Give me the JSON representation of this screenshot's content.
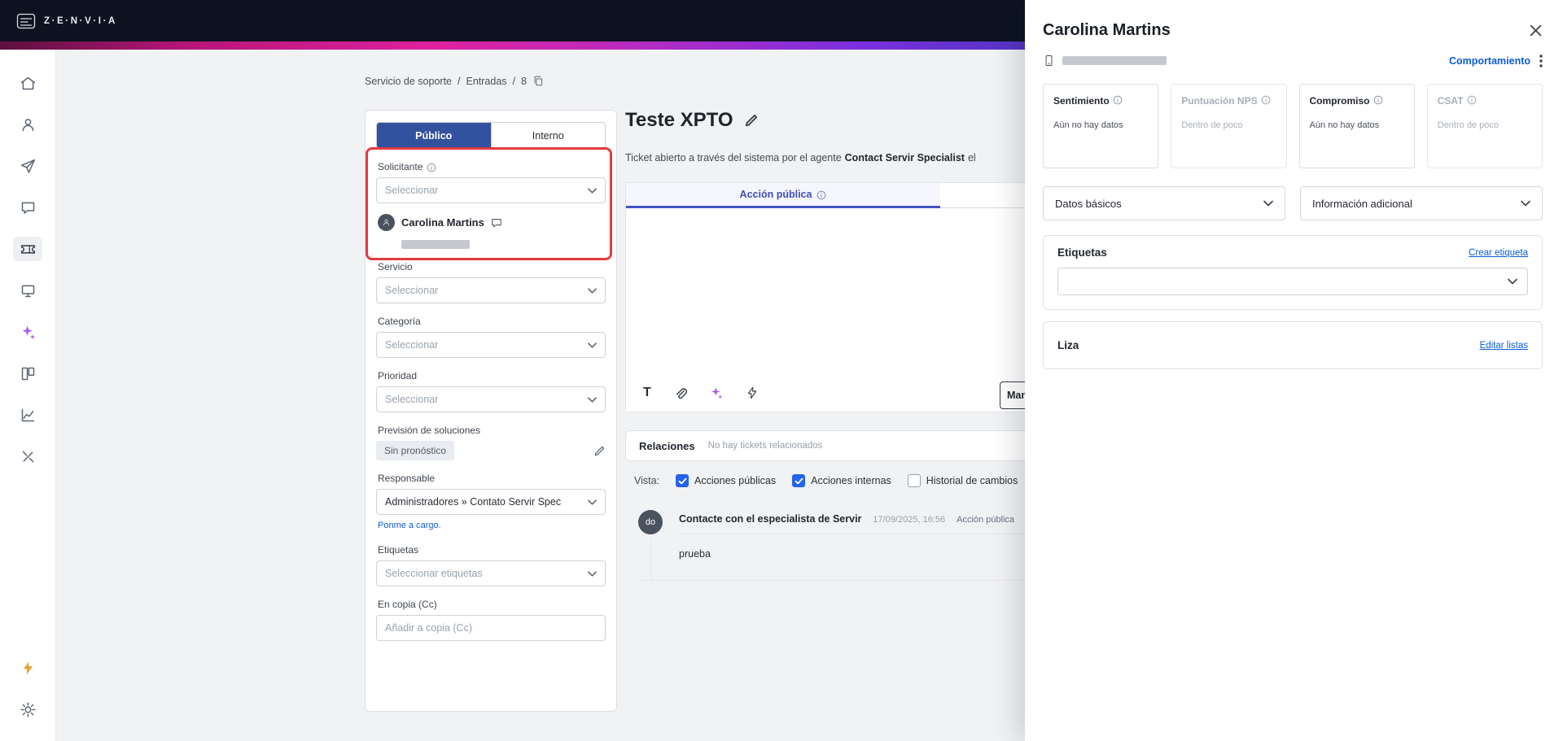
{
  "colors": {
    "topbar_bg": "#0c1220",
    "gradient_pink": "#e0219e",
    "gradient_purple": "#7b2fe0",
    "gradient_navy": "#1a1f4e",
    "link_blue": "#0b5cd5",
    "active_tab_blue": "#32519f",
    "action_tab_indigo": "#4353c4",
    "checkbox_blue": "#2563eb",
    "annotation_red": "#e23b3f",
    "sparkle_purple": "#a855f7",
    "zap_yellow": "#e9a23b"
  },
  "topbar": {
    "logo_text": "Z·E·N·V·I·A"
  },
  "breadcrumb": {
    "separator": "/",
    "parts": [
      "Servicio de soporte",
      "Entradas",
      "8"
    ]
  },
  "sidebar_icons": [
    "home-icon",
    "contacts-icon",
    "send-icon",
    "chat-icon",
    "tickets-icon",
    "workspace-icon",
    "ai-sparkles-icon",
    "kanban-icon",
    "analytics-icon",
    "tools-icon",
    "zap-icon",
    "settings-icon"
  ],
  "ticket_form": {
    "visibility_tabs": {
      "public": "Público",
      "internal": "Interno"
    },
    "solicitante": {
      "label": "Solicitante",
      "placeholder": "Seleccionar",
      "selected_name": "Carolina Martins"
    },
    "servicio": {
      "label": "Servicio",
      "placeholder": "Seleccionar"
    },
    "categoria": {
      "label": "Categoría",
      "placeholder": "Seleccionar"
    },
    "prioridad": {
      "label": "Prioridad",
      "placeholder": "Seleccionar"
    },
    "prevision": {
      "label": "Previsión de soluciones",
      "value": "Sin pronóstico"
    },
    "responsable": {
      "label": "Responsable",
      "value": "Administradores » Contato Servir Spec",
      "assign_link": "Ponme a cargo."
    },
    "etiquetas": {
      "label": "Etiquetas",
      "placeholder": "Seleccionar etiquetas"
    },
    "cc": {
      "label": "En copia (Cc)",
      "placeholder": "Añadir a copia (Cc)"
    }
  },
  "ticket": {
    "title": "Teste XPTO",
    "subtitle_prefix": "Ticket abierto a través del sistema por el agente",
    "subtitle_agent": "Contact Servir Specialist",
    "subtitle_suffix": "el",
    "action_tab": "Acción pública",
    "send_button": "Mandar",
    "relations": {
      "title": "Relaciones",
      "empty_text": "No hay tickets relacionados"
    },
    "vista": {
      "label": "Vista:",
      "options": [
        {
          "label": "Acciones públicas",
          "checked": true
        },
        {
          "label": "Acciones internas",
          "checked": true
        },
        {
          "label": "Historial de cambios",
          "checked": false
        }
      ]
    },
    "comment": {
      "avatar_initials": "do",
      "author": "Contacte con el especialista de Servir",
      "timestamp": "17/09/2025, 16:56",
      "badge": "Acción pública",
      "body": "prueba"
    }
  },
  "contact_panel": {
    "title": "Carolina Martins",
    "behavior_link": "Comportamiento",
    "metrics": [
      {
        "title": "Sentimiento",
        "value": "Aún no hay datos",
        "disabled": false
      },
      {
        "title": "Puntuación NPS",
        "value": "Dentro de poco",
        "disabled": true
      },
      {
        "title": "Compromiso",
        "value": "Aún no hay datos",
        "disabled": false
      },
      {
        "title": "CSAT",
        "value": "Dentro de poco",
        "disabled": true
      }
    ],
    "accordions": [
      "Datos básicos",
      "Información adicional"
    ],
    "tags_card": {
      "title": "Etiquetas",
      "action_link": "Crear etiqueta"
    },
    "lists_card": {
      "title": "Liza",
      "action_link": "Editar listas"
    }
  }
}
